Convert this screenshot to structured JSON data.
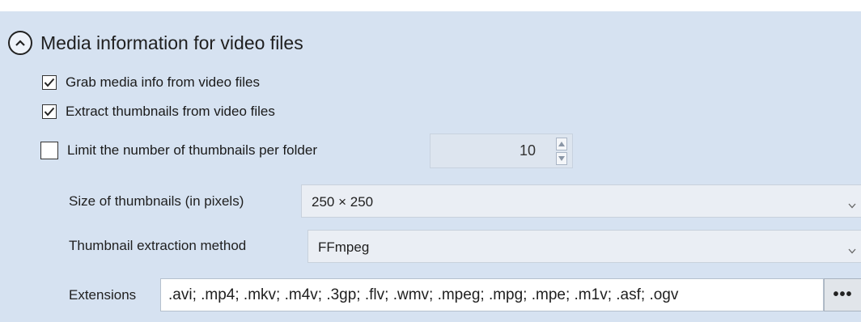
{
  "section": {
    "title": "Media information for video files",
    "collapse_icon": "chevron-up-circle-icon"
  },
  "options": {
    "grab_media_info": {
      "label": "Grab media info from video files",
      "checked": true
    },
    "extract_thumbnails": {
      "label": "Extract thumbnails from video files",
      "checked": true
    },
    "limit_thumbnails": {
      "label": "Limit the number of thumbnails per folder",
      "checked": false,
      "value": "10"
    }
  },
  "thumbnail_size": {
    "label": "Size of thumbnails (in pixels)",
    "value": "250 × 250"
  },
  "extraction_method": {
    "label": "Thumbnail extraction method",
    "value": "FFmpeg"
  },
  "extensions": {
    "label": "Extensions",
    "value": ".avi; .mp4; .mkv; .m4v; .3gp; .flv; .wmv; .mpeg; .mpg; .mpe; .m1v; .asf; .ogv",
    "browse_label": "•••"
  }
}
